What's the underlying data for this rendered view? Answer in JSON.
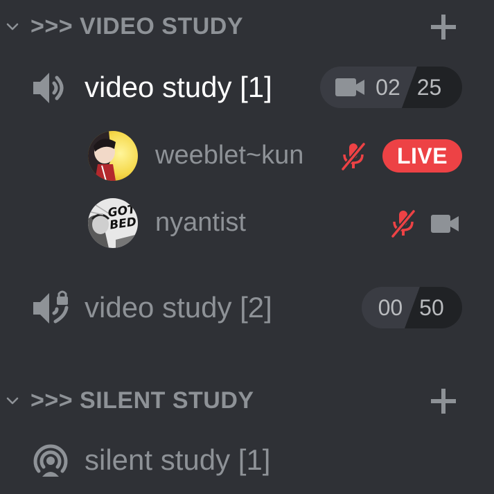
{
  "colors": {
    "background": "#2f3136",
    "muted_text": "#8e9297",
    "active_text": "#ffffff",
    "mute_red": "#ed4245",
    "live_red": "#ed4245"
  },
  "categories": [
    {
      "title": ">>> VIDEO STUDY",
      "chevron_icon": "chevron-down-icon",
      "add_icon": "plus-icon",
      "channels": [
        {
          "name": "video study [1]",
          "icon": "speaker-icon",
          "active": true,
          "counter": {
            "camera_icon": "video-camera-icon",
            "current": "02",
            "limit": "25"
          },
          "users": [
            {
              "name": "weeblet~kun",
              "muted": true,
              "badge": "LIVE"
            },
            {
              "name": "nyantist",
              "muted": true,
              "camera": true
            }
          ]
        },
        {
          "name": "video study [2]",
          "icon": "locked-speaker-icon",
          "active": false,
          "counter": {
            "current": "00",
            "limit": "50"
          }
        }
      ]
    },
    {
      "title": ">>> SILENT STUDY",
      "chevron_icon": "chevron-down-icon",
      "add_icon": "plus-icon",
      "channels": [
        {
          "name": "silent study [1]",
          "icon": "stage-icon",
          "active": false
        }
      ]
    }
  ]
}
